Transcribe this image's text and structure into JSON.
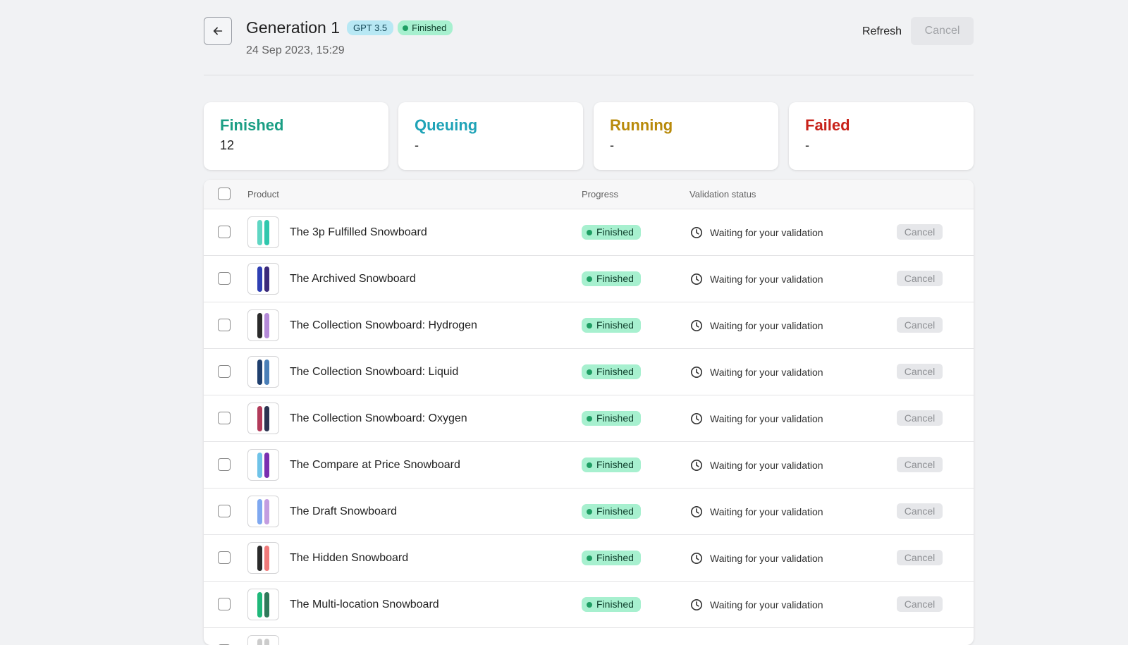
{
  "header": {
    "title": "Generation 1",
    "model_badge": "GPT 3.5",
    "status_badge": "Finished",
    "timestamp": "24 Sep 2023, 15:29",
    "refresh_label": "Refresh",
    "cancel_label": "Cancel",
    "back_icon": "arrow-left-icon"
  },
  "stats": [
    {
      "label": "Finished",
      "value": "12",
      "color": "#1a9e84"
    },
    {
      "label": "Queuing",
      "value": "-",
      "color": "#1fa3b7"
    },
    {
      "label": "Running",
      "value": "-",
      "color": "#b88a0a"
    },
    {
      "label": "Failed",
      "value": "-",
      "color": "#c8221a"
    }
  ],
  "table": {
    "columns": {
      "product": "Product",
      "progress": "Progress",
      "validation": "Validation status"
    },
    "rows": [
      {
        "name": "The 3p Fulfilled Snowboard",
        "progress": "Finished",
        "validation": "Waiting for your validation",
        "cancel": "Cancel",
        "colors": [
          "#5fd6c3",
          "#2fc7ad"
        ]
      },
      {
        "name": "The Archived Snowboard",
        "progress": "Finished",
        "validation": "Waiting for your validation",
        "cancel": "Cancel",
        "colors": [
          "#2e3fb3",
          "#3b2a7a"
        ]
      },
      {
        "name": "The Collection Snowboard: Hydrogen",
        "progress": "Finished",
        "validation": "Waiting for your validation",
        "cancel": "Cancel",
        "colors": [
          "#2a2a2a",
          "#b48ad8"
        ]
      },
      {
        "name": "The Collection Snowboard: Liquid",
        "progress": "Finished",
        "validation": "Waiting for your validation",
        "cancel": "Cancel",
        "colors": [
          "#1f3f6e",
          "#4a7fb8"
        ]
      },
      {
        "name": "The Collection Snowboard: Oxygen",
        "progress": "Finished",
        "validation": "Waiting for your validation",
        "cancel": "Cancel",
        "colors": [
          "#b23b5a",
          "#2b3350"
        ]
      },
      {
        "name": "The Compare at Price Snowboard",
        "progress": "Finished",
        "validation": "Waiting for your validation",
        "cancel": "Cancel",
        "colors": [
          "#6fc3e8",
          "#7a2fb0"
        ]
      },
      {
        "name": "The Draft Snowboard",
        "progress": "Finished",
        "validation": "Waiting for your validation",
        "cancel": "Cancel",
        "colors": [
          "#7fa8f0",
          "#c39de0"
        ]
      },
      {
        "name": "The Hidden Snowboard",
        "progress": "Finished",
        "validation": "Waiting for your validation",
        "cancel": "Cancel",
        "colors": [
          "#2a2a2a",
          "#f07a7a"
        ]
      },
      {
        "name": "The Multi-location Snowboard",
        "progress": "Finished",
        "validation": "Waiting for your validation",
        "cancel": "Cancel",
        "colors": [
          "#1fb87a",
          "#2f7a5a"
        ]
      },
      {
        "name": "",
        "progress": "",
        "validation": "",
        "cancel": "",
        "colors": [
          "#cccccc",
          "#cccccc"
        ]
      }
    ]
  }
}
